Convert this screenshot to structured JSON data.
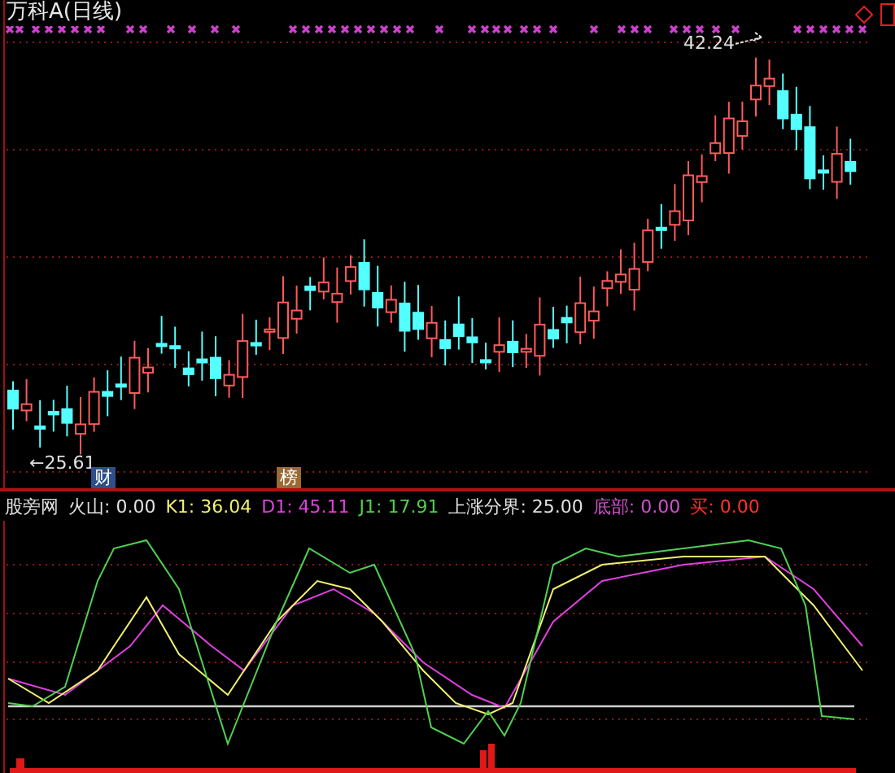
{
  "title": "万科A(日线)",
  "price_labels": [
    {
      "kind": "high",
      "text": "42.24"
    },
    {
      "kind": "low",
      "text": "←25.61"
    }
  ],
  "event_badges": [
    {
      "text": "财",
      "color": "#2e4f8a"
    },
    {
      "text": "榜",
      "color": "#9a6a34"
    }
  ],
  "legend": [
    {
      "text": "股旁网",
      "color": "#e0e0e0"
    },
    {
      "text": "火山: 0.00",
      "color": "#e0e0e0"
    },
    {
      "text": "K1: 36.04",
      "color": "#f0f070"
    },
    {
      "text": "D1: 45.11",
      "color": "#e040e0"
    },
    {
      "text": "J1: 17.91",
      "color": "#50d050"
    },
    {
      "text": "上涨分界: 25.00",
      "color": "#e0e0e0"
    },
    {
      "text": "底部: 0.00",
      "color": "#d050d0"
    },
    {
      "text": "买: 0.00",
      "color": "#ff3030"
    }
  ]
}
